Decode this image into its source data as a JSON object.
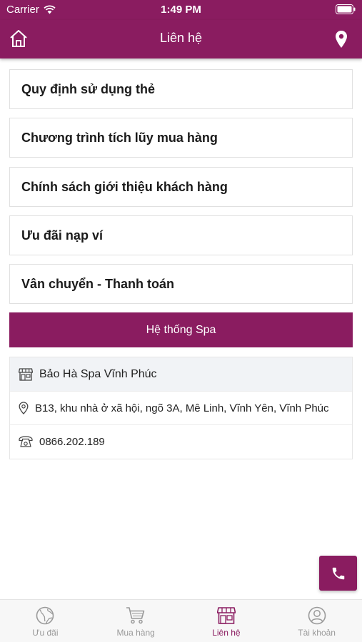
{
  "status_bar": {
    "carrier": "Carrier",
    "time": "1:49 PM"
  },
  "header": {
    "title": "Liên hệ"
  },
  "menu": [
    {
      "label": "Quy định sử dụng thẻ"
    },
    {
      "label": "Chương trình tích lũy mua hàng"
    },
    {
      "label": "Chính sách giới thiệu khách hàng"
    },
    {
      "label": "Ưu đãi nạp ví"
    },
    {
      "label": "Vân chuyển - Thanh toán"
    }
  ],
  "spa_section": {
    "title": "Hệ thống Spa",
    "name": "Bảo Hà Spa Vĩnh Phúc",
    "address": "B13, khu nhà ở xã hội, ngõ 3A, Mê Linh, Vĩnh Yên, Vĩnh Phúc",
    "phone": "0866.202.189"
  },
  "tabs": [
    {
      "label": "Ưu đãi",
      "icon": "globe-icon",
      "active": false
    },
    {
      "label": "Mua hàng",
      "icon": "cart-icon",
      "active": false
    },
    {
      "label": "Liên hệ",
      "icon": "store-icon",
      "active": true
    },
    {
      "label": "Tài khoản",
      "icon": "user-icon",
      "active": false
    }
  ],
  "colors": {
    "primary": "#8a1c60",
    "tab_inactive": "#9a9a9a",
    "spa_name_bg": "#f1f3f6"
  }
}
